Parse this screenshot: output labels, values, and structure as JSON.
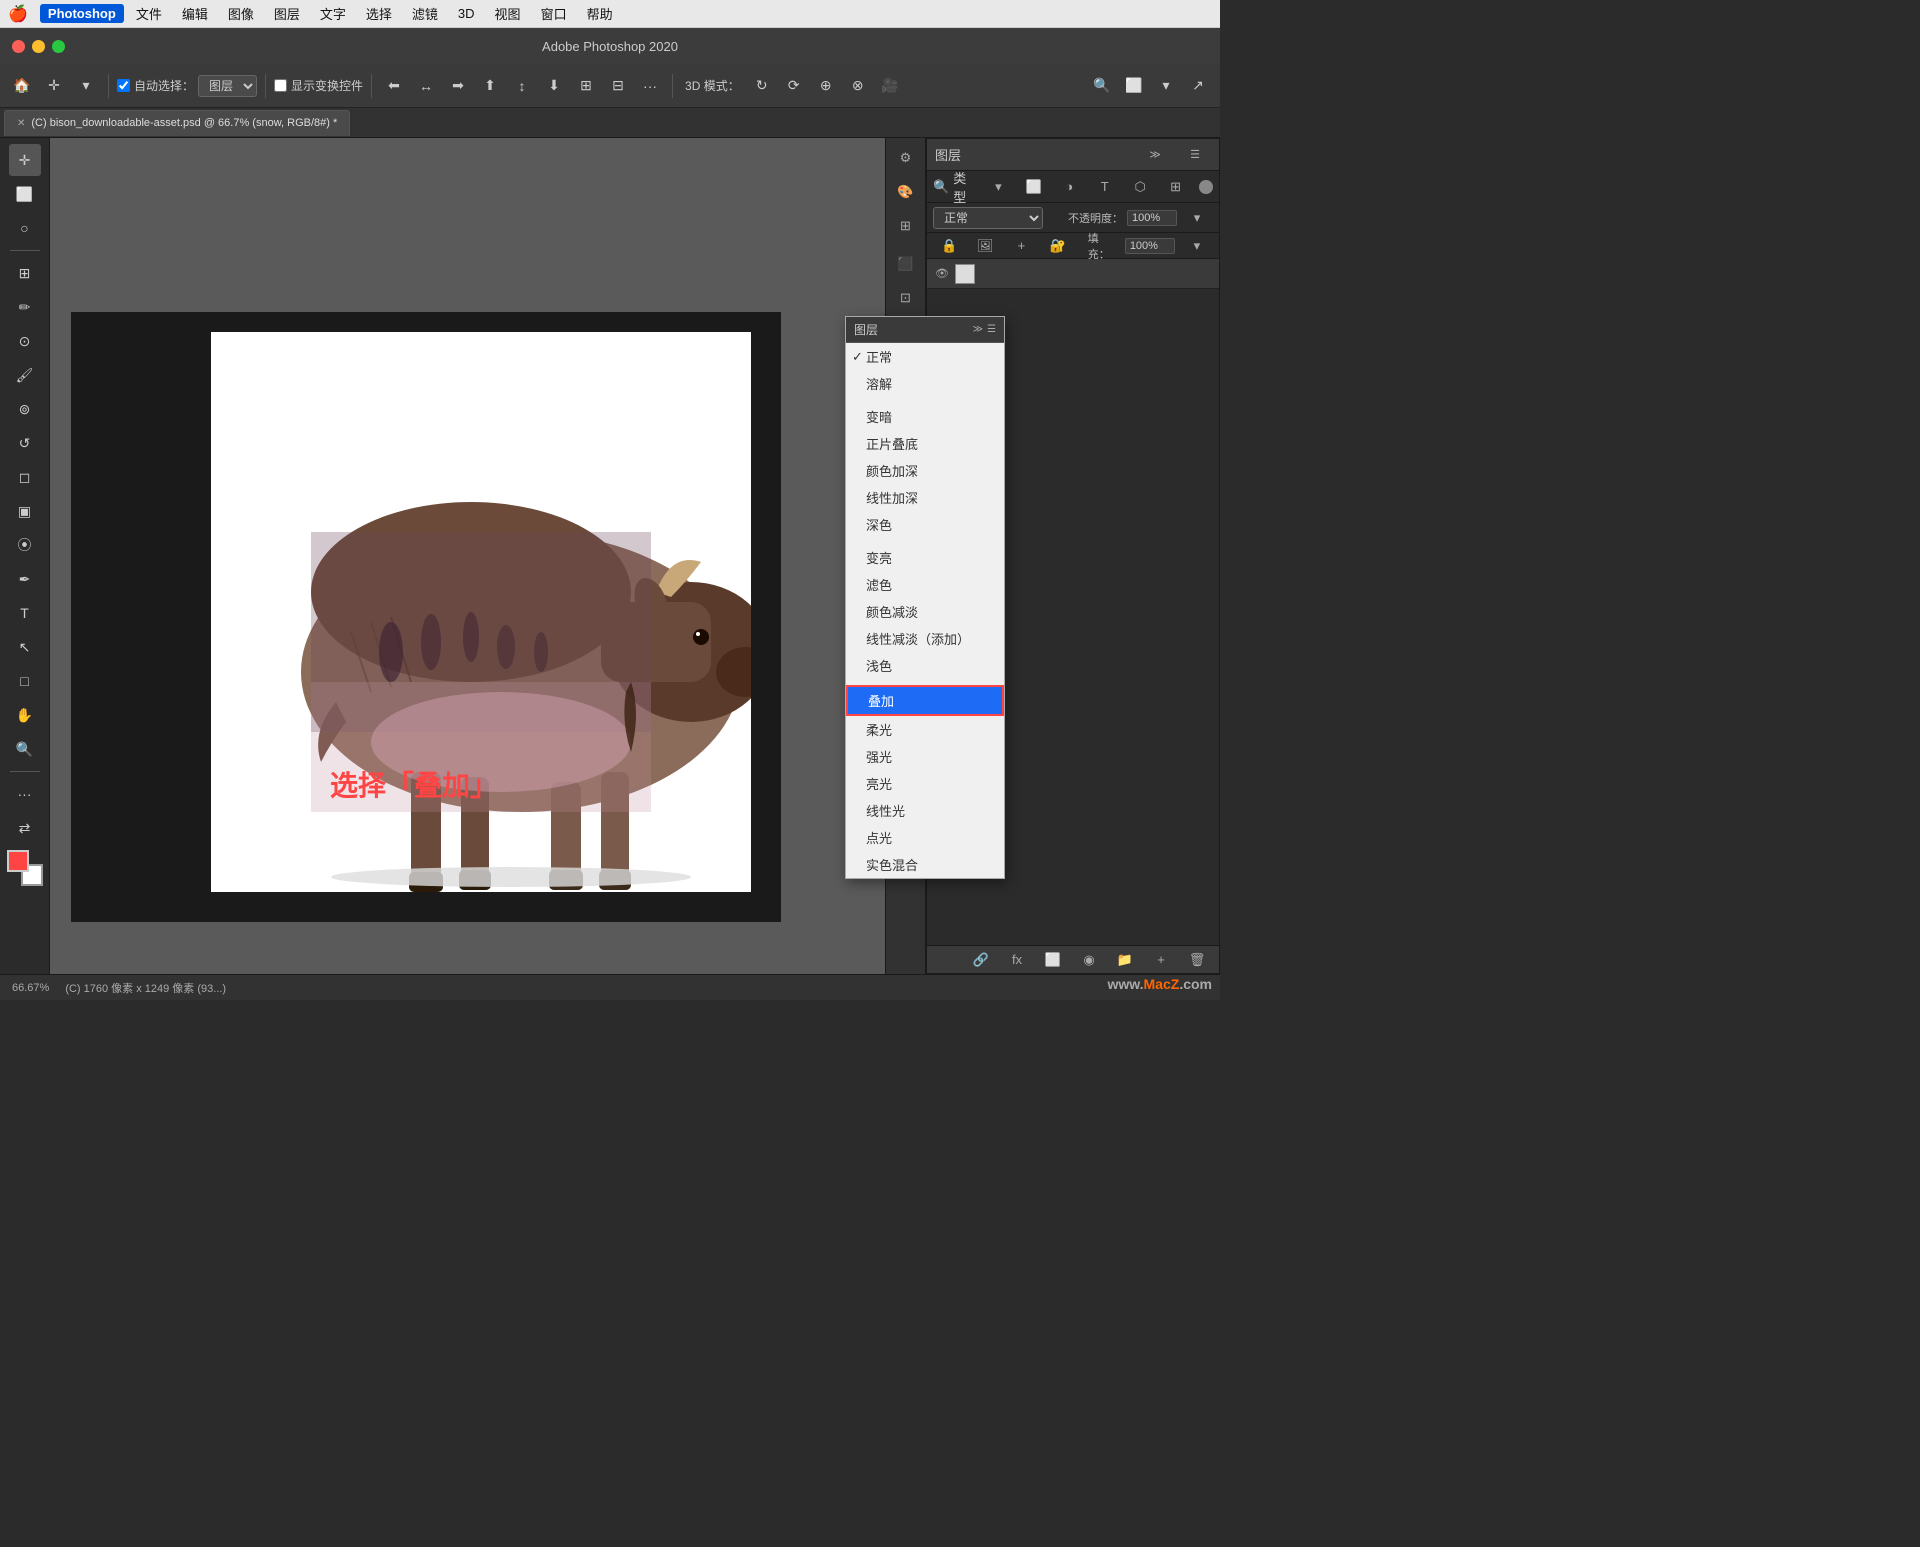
{
  "app": {
    "name": "Photoshop",
    "title": "Adobe Photoshop 2020",
    "tab_title": "(C) bison_downloadable-asset.psd @ 66.7% (snow, RGB/8#) *"
  },
  "menubar": {
    "apple": "🍎",
    "items": [
      "Photoshop",
      "文件",
      "编辑",
      "图像",
      "图层",
      "文字",
      "选择",
      "滤镜",
      "3D",
      "视图",
      "窗口",
      "帮助"
    ]
  },
  "toolbar": {
    "auto_select_label": "自动选择：",
    "layer_label": "图层",
    "show_transform_label": "显示变换控件",
    "mode_3d": "3D 模式："
  },
  "layers_panel": {
    "title": "图层",
    "filter_label": "类型",
    "opacity_label": "不透明度：",
    "opacity_value": "100%",
    "fill_label": "填充：",
    "fill_value": "100%"
  },
  "blend_modes": {
    "header": "图层",
    "groups": [
      {
        "items": [
          {
            "label": "正常",
            "checked": true
          },
          {
            "label": "溶解",
            "checked": false
          }
        ]
      },
      {
        "items": [
          {
            "label": "变暗",
            "checked": false
          },
          {
            "label": "正片叠底",
            "checked": false
          },
          {
            "label": "颜色加深",
            "checked": false
          },
          {
            "label": "线性加深",
            "checked": false
          },
          {
            "label": "深色",
            "checked": false
          }
        ]
      },
      {
        "items": [
          {
            "label": "变亮",
            "checked": false
          },
          {
            "label": "滤色",
            "checked": false
          },
          {
            "label": "颜色减淡",
            "checked": false
          },
          {
            "label": "线性减淡（添加）",
            "checked": false
          },
          {
            "label": "浅色",
            "checked": false
          }
        ]
      },
      {
        "items": [
          {
            "label": "叠加",
            "checked": false,
            "highlighted": true
          },
          {
            "label": "柔光",
            "checked": false
          },
          {
            "label": "强光",
            "checked": false
          },
          {
            "label": "亮光",
            "checked": false
          },
          {
            "label": "线性光",
            "checked": false
          },
          {
            "label": "点光",
            "checked": false
          },
          {
            "label": "实色混合",
            "checked": false
          }
        ]
      }
    ]
  },
  "instruction": {
    "text": "选择「叠加」"
  },
  "statusbar": {
    "zoom": "66.67%",
    "info": "(C) 1760 像素 x 1249 像素 (93...)"
  },
  "watermark": {
    "prefix": "www.",
    "domain": "MacZ",
    "suffix": ".com"
  }
}
